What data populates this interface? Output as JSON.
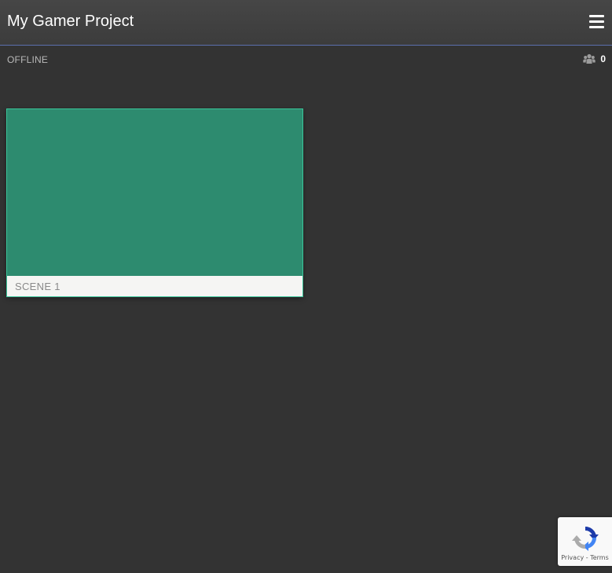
{
  "header": {
    "title": "My Gamer Project",
    "menu_icon": "hamburger-menu-icon"
  },
  "status": {
    "connection": "OFFLINE",
    "viewers_icon": "users-group-icon",
    "viewers_count": "0"
  },
  "scenes": [
    {
      "label": "SCENE 1",
      "thumbnail_color": "#2d8b6f"
    }
  ],
  "recaptcha": {
    "privacy_label": "Privacy",
    "separator": "-",
    "terms_label": "Terms"
  },
  "colors": {
    "background": "#333333",
    "header": "#424242",
    "accent_border": "#3ac59a",
    "header_underline": "#5b6fae"
  }
}
